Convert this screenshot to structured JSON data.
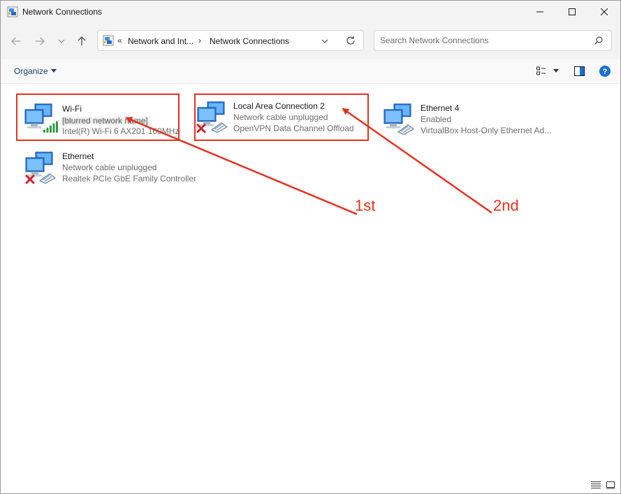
{
  "window": {
    "title": "Network Connections",
    "controls": {
      "minimize": "minimize",
      "maximize": "maximize",
      "close": "close"
    }
  },
  "address_bar": {
    "overflow": "«",
    "crumbs": [
      "Network and Int...",
      "Network Connections"
    ],
    "separator": "›"
  },
  "search": {
    "placeholder": "Search Network Connections"
  },
  "command_bar": {
    "organize_label": "Organize"
  },
  "connections": [
    {
      "name": "Wi-Fi",
      "line2": "[blurred network name]",
      "line3": "Intel(R) Wi-Fi 6 AX201 160MHz",
      "status_icon": "signal-bars-icon"
    },
    {
      "name": "Local Area Connection 2",
      "line2": "Network cable unplugged",
      "line3": "OpenVPN Data Channel Offload",
      "status_icon": "red-x-icon"
    },
    {
      "name": "Ethernet 4",
      "line2": "Enabled",
      "line3": "VirtualBox Host-Only Ethernet Ad...",
      "status_icon": "cable-icon"
    },
    {
      "name": "Ethernet",
      "line2": "Network cable unplugged",
      "line3": "Realtek PCIe GbE Family Controller",
      "status_icon": "red-x-icon"
    }
  ],
  "annotations": {
    "first": "1st",
    "second": "2nd",
    "color": "#e8301c"
  },
  "colors": {
    "titlebar": "#f3f3f3",
    "accent": "#1a6fd6",
    "help": "#1a6fd6"
  }
}
